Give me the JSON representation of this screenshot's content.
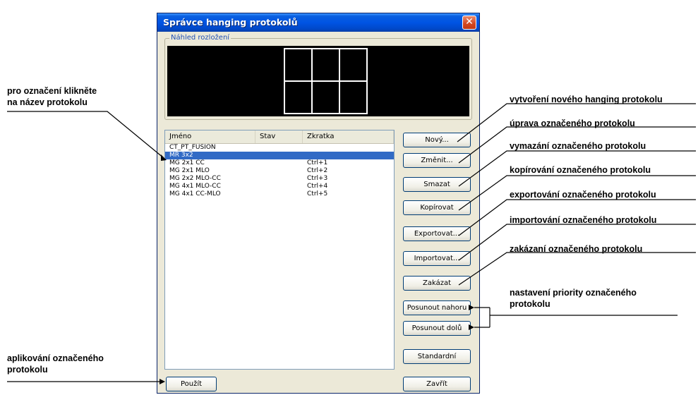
{
  "window": {
    "title": "Správce hanging protokolů",
    "close_glyph": "✕"
  },
  "preview": {
    "legend": "Náhled rozložení"
  },
  "list": {
    "headers": {
      "name": "Jméno",
      "state": "Stav",
      "shortcut": "Zkratka"
    },
    "rows": [
      {
        "name": "CT_PT_FUSION",
        "state": "",
        "shortcut": ""
      },
      {
        "name": "MR 3x2",
        "state": "",
        "shortcut": "",
        "selected": true
      },
      {
        "name": "MG 2x1 CC",
        "state": "",
        "shortcut": "Ctrl+1"
      },
      {
        "name": "MG 2x1 MLO",
        "state": "",
        "shortcut": "Ctrl+2"
      },
      {
        "name": "MG 2x2 MLO-CC",
        "state": "",
        "shortcut": "Ctrl+3"
      },
      {
        "name": "MG 4x1 MLO-CC",
        "state": "",
        "shortcut": "Ctrl+4"
      },
      {
        "name": "MG 4x1 CC-MLO",
        "state": "",
        "shortcut": "Ctrl+5"
      }
    ]
  },
  "buttons": {
    "new": "Nový...",
    "edit": "Změnit...",
    "delete": "Smazat",
    "copy": "Kopírovat",
    "export": "Exportovat...",
    "import": "Importovat...",
    "disable": "Zakázat",
    "move_up": "Posunout nahoru",
    "move_down": "Posunout dolů",
    "standard": "Standardní",
    "apply": "Použít",
    "close": "Zavřít"
  },
  "annotations": {
    "click_name_line1": "pro označení klikněte",
    "click_name_line2": "na název protokolu",
    "new": "vytvoření nového hanging protokolu",
    "edit": "úprava označeného protokolu",
    "delete": "vymazání označeného protokolu",
    "copy": "kopírování označeného protokolu",
    "export": "exportování označeného protokolu",
    "import": "importování označeného protokolu",
    "disable": "zakázaní označeného protokolu",
    "priority_line1": "nastavení priority označeného",
    "priority_line2": "protokolu",
    "apply_line1": "aplikování označeného",
    "apply_line2": "protokolu"
  }
}
